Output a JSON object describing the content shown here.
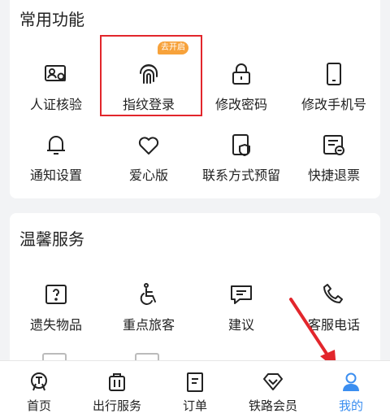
{
  "sections": {
    "common": {
      "title": "常用功能",
      "items": [
        {
          "label": "人证核验",
          "icon": "id-verify-icon"
        },
        {
          "label": "指纹登录",
          "icon": "fingerprint-icon",
          "badge": "去开启"
        },
        {
          "label": "修改密码",
          "icon": "lock-icon"
        },
        {
          "label": "修改手机号",
          "icon": "phone-icon"
        },
        {
          "label": "通知设置",
          "icon": "bell-icon"
        },
        {
          "label": "爱心版",
          "icon": "heart-icon"
        },
        {
          "label": "联系方式预留",
          "icon": "contact-shield-icon"
        },
        {
          "label": "快捷退票",
          "icon": "refund-ticket-icon"
        }
      ]
    },
    "service": {
      "title": "温馨服务",
      "items": [
        {
          "label": "遗失物品",
          "icon": "lost-item-icon"
        },
        {
          "label": "重点旅客",
          "icon": "wheelchair-icon"
        },
        {
          "label": "建议",
          "icon": "feedback-icon"
        },
        {
          "label": "客服电话",
          "icon": "phone-call-icon"
        }
      ]
    }
  },
  "tabbar": {
    "items": [
      {
        "label": "首页",
        "icon": "railway-home-icon"
      },
      {
        "label": "出行服务",
        "icon": "luggage-icon"
      },
      {
        "label": "订单",
        "icon": "order-icon"
      },
      {
        "label": "铁路会员",
        "icon": "diamond-icon"
      },
      {
        "label": "我的",
        "icon": "user-icon",
        "active": true
      }
    ]
  },
  "colors": {
    "accent": "#3b8ef0",
    "badge": "#f7a23b",
    "highlight": "#e2262c"
  }
}
